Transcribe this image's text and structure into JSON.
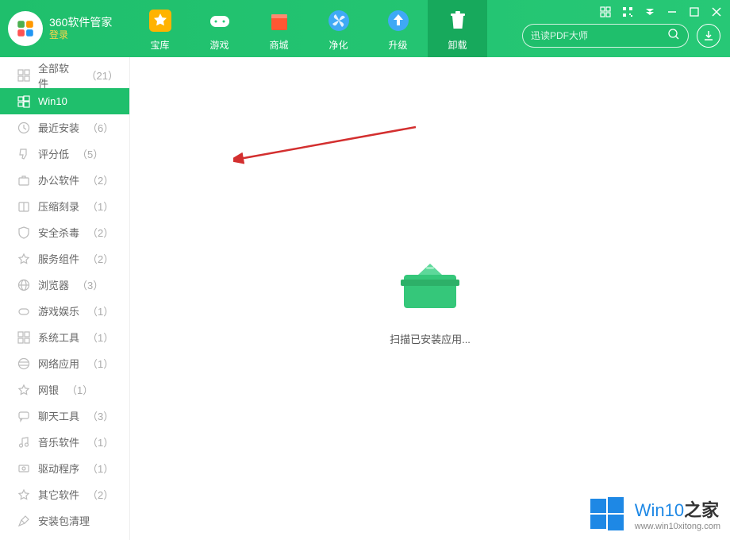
{
  "app": {
    "title": "360软件管家",
    "login_label": "登录"
  },
  "nav": {
    "items": [
      {
        "label": "宝库",
        "icon": "star"
      },
      {
        "label": "游戏",
        "icon": "gamepad"
      },
      {
        "label": "商城",
        "icon": "shop"
      },
      {
        "label": "净化",
        "icon": "fan"
      },
      {
        "label": "升级",
        "icon": "upgrade"
      },
      {
        "label": "卸载",
        "icon": "trash",
        "active": true
      }
    ]
  },
  "search": {
    "placeholder": "迅读PDF大师"
  },
  "sidebar": {
    "items": [
      {
        "label": "全部软件",
        "count": "（21）",
        "icon": "grid"
      },
      {
        "label": "Win10",
        "count": "",
        "icon": "win",
        "active": true
      },
      {
        "label": "最近安装",
        "count": "（6）",
        "icon": "clock"
      },
      {
        "label": "评分低",
        "count": "（5）",
        "icon": "thumbs-down"
      },
      {
        "label": "办公软件",
        "count": "（2）",
        "icon": "briefcase"
      },
      {
        "label": "压缩刻录",
        "count": "（1）",
        "icon": "archive"
      },
      {
        "label": "安全杀毒",
        "count": "（2）",
        "icon": "shield"
      },
      {
        "label": "服务组件",
        "count": "（2）",
        "icon": "star-o"
      },
      {
        "label": "浏览器",
        "count": "（3）",
        "icon": "globe"
      },
      {
        "label": "游戏娱乐",
        "count": "（1）",
        "icon": "game"
      },
      {
        "label": "系统工具",
        "count": "（1）",
        "icon": "tools"
      },
      {
        "label": "网络应用",
        "count": "（1）",
        "icon": "network"
      },
      {
        "label": "网银",
        "count": "（1）",
        "icon": "star-o"
      },
      {
        "label": "聊天工具",
        "count": "（3）",
        "icon": "chat"
      },
      {
        "label": "音乐软件",
        "count": "（1）",
        "icon": "music"
      },
      {
        "label": "驱动程序",
        "count": "（1）",
        "icon": "driver"
      },
      {
        "label": "其它软件",
        "count": "（2）",
        "icon": "star-o"
      },
      {
        "label": "安装包清理",
        "count": "",
        "icon": "broom"
      }
    ]
  },
  "main": {
    "scan_text": "扫描已安装应用..."
  },
  "watermark": {
    "brand1": "Win10",
    "brand2": "之家",
    "url": "www.win10xitong.com"
  }
}
